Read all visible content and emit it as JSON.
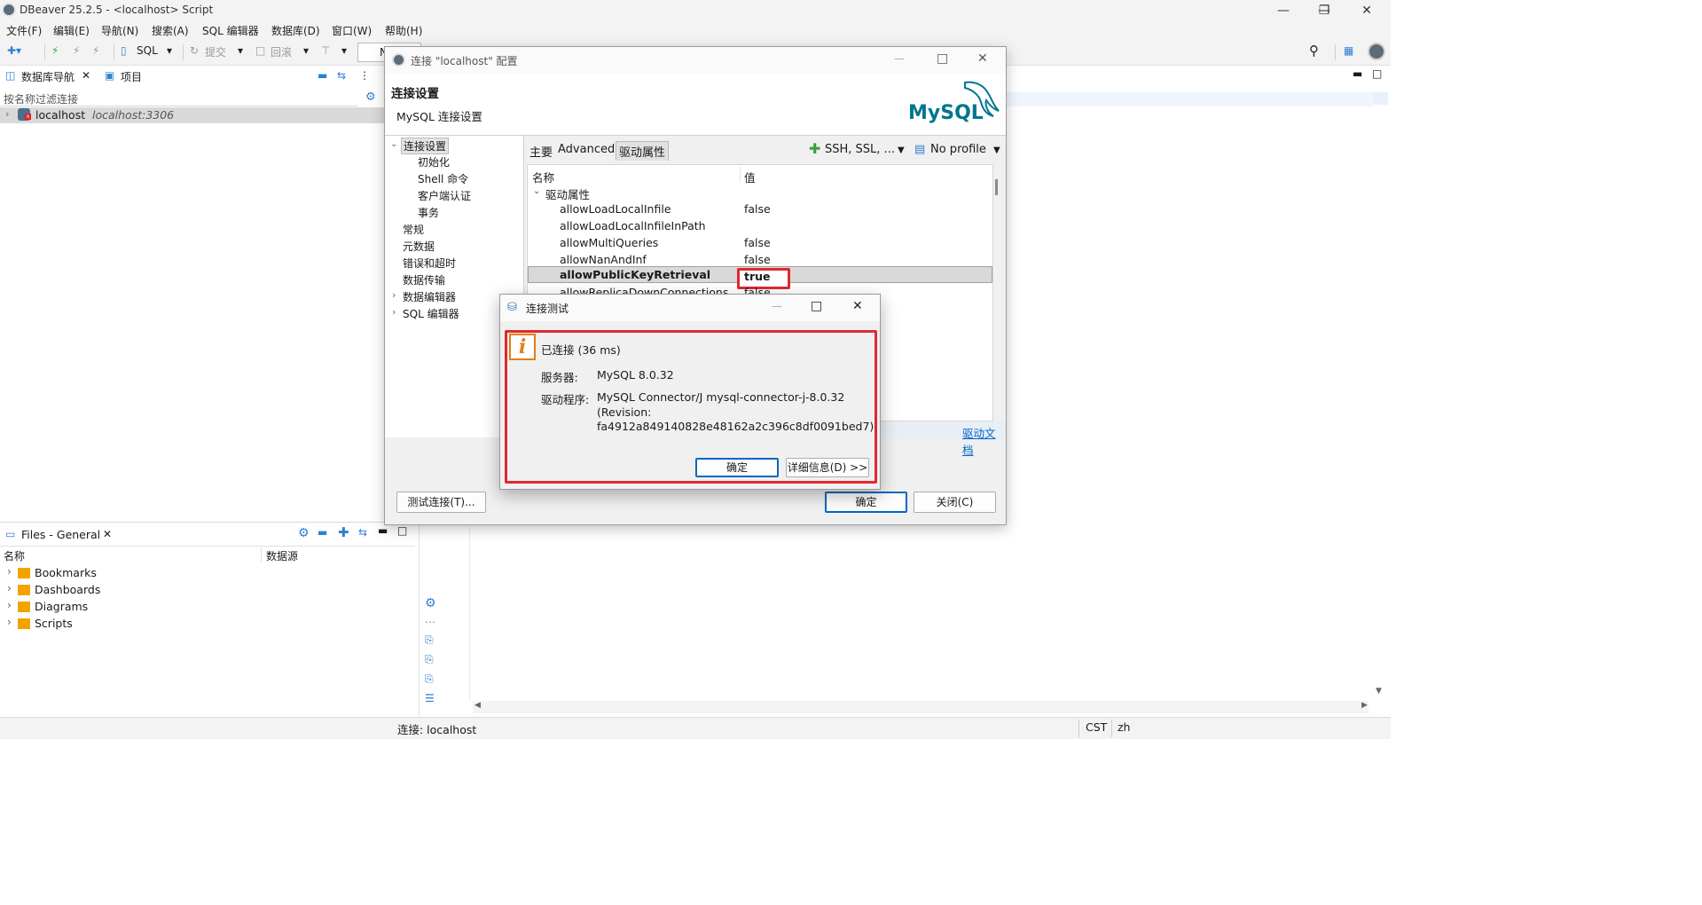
{
  "window": {
    "title": "DBeaver 25.2.5 - <localhost> Script"
  },
  "menu": [
    "文件(F)",
    "编辑(E)",
    "导航(N)",
    "搜索(A)",
    "SQL 编辑器",
    "数据库(D)",
    "窗口(W)",
    "帮助(H)"
  ],
  "toolbar": {
    "sql_label": "SQL",
    "commit_label": "提交",
    "rollback_label": "回滚",
    "combo_value": "N"
  },
  "nav": {
    "tab_db_navigator": "数据库导航",
    "tab_projects": "项目",
    "filter_placeholder": "按名称过滤连接",
    "connection_name": "localhost",
    "connection_host": "localhost:3306"
  },
  "files": {
    "tab_title": "Files - General",
    "col_name": "名称",
    "col_source": "数据源",
    "items": [
      "Bookmarks",
      "Dashboards",
      "Diagrams",
      "Scripts"
    ]
  },
  "conn_dialog": {
    "title": "连接 \"localhost\" 配置",
    "header_title": "连接设置",
    "header_subtitle": "MySQL 连接设置",
    "logo_text": "MySQL",
    "tree": [
      "连接设置",
      "初始化",
      "Shell 命令",
      "客户端认证",
      "事务",
      "常规",
      "元数据",
      "错误和超时",
      "数据传输",
      "数据编辑器",
      "SQL 编辑器"
    ],
    "tabs": [
      "主要",
      "Advanced",
      "驱动属性"
    ],
    "ssh_label": "SSH, SSL, ...",
    "profile_label": "No profile",
    "col_name": "名称",
    "col_value": "值",
    "group_label": "驱动属性",
    "properties": [
      {
        "name": "allowLoadLocalInfile",
        "value": "false"
      },
      {
        "name": "allowLoadLocalInfileInPath",
        "value": ""
      },
      {
        "name": "allowMultiQueries",
        "value": "false"
      },
      {
        "name": "allowNanAndInf",
        "value": "false"
      },
      {
        "name": "allowPublicKeyRetrieval",
        "value": "true"
      },
      {
        "name": "allowReplicaDownConnections",
        "value": "false"
      }
    ],
    "driver_docs_link": "驱动文档",
    "test_button": "测试连接(T)...",
    "ok_button": "确定",
    "close_button": "关闭(C)"
  },
  "test_dialog": {
    "title": "连接测试",
    "message": "已连接 (36 ms)",
    "server_label": "服务器:",
    "server_value": "MySQL 8.0.32",
    "driver_label": "驱动程序:",
    "driver_line1": "MySQL Connector/J mysql-connector-j-8.0.32",
    "driver_line2": "(Revision:",
    "driver_line3": "fa4912a849140828e48162a2c396c8df0091bed7)",
    "ok_button": "确定",
    "details_button": "详细信息(D) >>"
  },
  "status": {
    "connection": "连接: localhost",
    "timezone": "CST",
    "locale": "zh"
  },
  "colors": {
    "accent": "#0067c0",
    "highlight_red": "#e0282f",
    "info_orange": "#e57f14",
    "mysql_blue": "#00758f",
    "mysql_orange": "#f29111"
  }
}
